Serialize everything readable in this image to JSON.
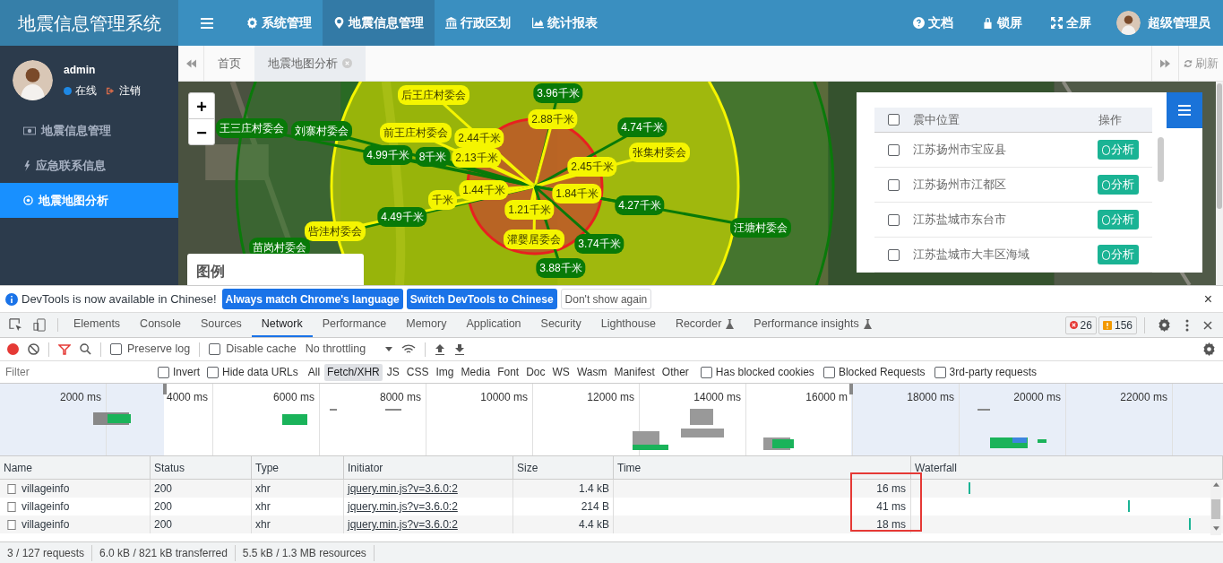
{
  "app": {
    "logo": "地震信息管理系统",
    "nav": [
      {
        "label": "系统管理",
        "kind": "gear",
        "selected": false
      },
      {
        "label": "地震信息管理",
        "kind": "pin",
        "selected": true
      },
      {
        "label": "行政区划",
        "kind": "bank",
        "selected": false
      },
      {
        "label": "统计报表",
        "kind": "chart",
        "selected": false
      }
    ],
    "nav_right": [
      {
        "label": "文档",
        "kind": "help"
      },
      {
        "label": "锁屏",
        "kind": "lock"
      },
      {
        "label": "全屏",
        "kind": "expand"
      }
    ],
    "user_name": "超级管理员",
    "sidebar": {
      "user": "admin",
      "status": "在线",
      "logout": "注销",
      "items": [
        {
          "label": "地震信息管理",
          "kind": "money",
          "selected": false
        },
        {
          "label": "应急联系信息",
          "kind": "bolt",
          "selected": false
        },
        {
          "label": "地震地图分析",
          "kind": "target",
          "selected": true
        }
      ]
    },
    "page_tabs": [
      {
        "label": "首页",
        "selected": false,
        "closable": false
      },
      {
        "label": "地震地图分析",
        "selected": true,
        "closable": true
      }
    ],
    "refresh": "刷新",
    "map": {
      "zoom_in": "+",
      "zoom_out": "−",
      "legend": "图例",
      "labels": [
        {
          "text": "后王庄村委会",
          "color": "#f5f500"
        },
        {
          "text": "3.96千米",
          "color": "#087a08"
        },
        {
          "text": "2.88千米",
          "color": "#f5f500"
        },
        {
          "text": "王三庄村委会",
          "color": "#087a08"
        },
        {
          "text": "刘寨村委会",
          "color": "#087a08"
        },
        {
          "text": "前王庄村委会",
          "color": "#f5f500"
        },
        {
          "text": "2.44千米",
          "color": "#f5f500"
        },
        {
          "text": "4.74千米",
          "color": "#087a08"
        },
        {
          "text": "4.99千米",
          "color": "#087a08"
        },
        {
          "text": "8千米",
          "color": "#087a08"
        },
        {
          "text": "2.13千米",
          "color": "#f5f500"
        },
        {
          "text": "2.45千米",
          "color": "#f5f500"
        },
        {
          "text": "张集村委会",
          "color": "#f5f500"
        },
        {
          "text": "4.49千米",
          "color": "#087a08"
        },
        {
          "text": "千米",
          "color": "#f5f500"
        },
        {
          "text": "1.44千米",
          "color": "#f5f500"
        },
        {
          "text": "1.21千米",
          "color": "#f5f500"
        },
        {
          "text": "1.84千米",
          "color": "#f5f500"
        },
        {
          "text": "4.27千米",
          "color": "#087a08"
        },
        {
          "text": "苗岗村委会",
          "color": "#087a08"
        },
        {
          "text": "呰洼村委会",
          "color": "#f5f500"
        },
        {
          "text": "灌婴居委会",
          "color": "#f5f500"
        },
        {
          "text": "3.74千米",
          "color": "#087a08"
        },
        {
          "text": "汪塘村委会",
          "color": "#087a08"
        },
        {
          "text": "3.88千米",
          "color": "#087a08"
        }
      ]
    },
    "quake_table": {
      "columns": [
        "震中位置",
        "操作"
      ],
      "all_checked": false,
      "rows": [
        {
          "location": "江苏扬州市宝应县",
          "checked": false,
          "action": "分析"
        },
        {
          "location": "江苏扬州市江都区",
          "checked": false,
          "action": "分析"
        },
        {
          "location": "江苏盐城市东台市",
          "checked": false,
          "action": "分析"
        },
        {
          "location": "江苏盐城市大丰区海域",
          "checked": false,
          "action": "分析"
        }
      ]
    }
  },
  "devtools": {
    "infobar": {
      "message": "DevTools is now available in Chinese!",
      "buttons": [
        {
          "label": "Always match Chrome's language",
          "kind": "primary"
        },
        {
          "label": "Switch DevTools to Chinese",
          "kind": "primary"
        },
        {
          "label": "Don't show again",
          "kind": "plain"
        }
      ],
      "close": "×"
    },
    "tabs": [
      {
        "label": "Elements",
        "selected": false,
        "experimental": false
      },
      {
        "label": "Console",
        "selected": false,
        "experimental": false
      },
      {
        "label": "Sources",
        "selected": false,
        "experimental": false
      },
      {
        "label": "Network",
        "selected": true,
        "experimental": false
      },
      {
        "label": "Performance",
        "selected": false,
        "experimental": false
      },
      {
        "label": "Memory",
        "selected": false,
        "experimental": false
      },
      {
        "label": "Application",
        "selected": false,
        "experimental": false
      },
      {
        "label": "Security",
        "selected": false,
        "experimental": false
      },
      {
        "label": "Lighthouse",
        "selected": false,
        "experimental": false
      },
      {
        "label": "Recorder",
        "selected": false,
        "experimental": true
      },
      {
        "label": "Performance insights",
        "selected": false,
        "experimental": true
      }
    ],
    "errors": "26",
    "warnings": "156",
    "toolbar": {
      "recording": true,
      "preserve_log": {
        "label": "Preserve log",
        "checked": false
      },
      "disable_cache": {
        "label": "Disable cache",
        "checked": false
      },
      "throttling": "No throttling"
    },
    "filter": {
      "placeholder": "Filter",
      "options": [
        {
          "label": "Invert",
          "checked": false
        },
        {
          "label": "Hide data URLs",
          "checked": false
        }
      ],
      "types": [
        {
          "label": "All",
          "selected": false
        },
        {
          "label": "Fetch/XHR",
          "selected": true
        },
        {
          "label": "JS",
          "selected": false
        },
        {
          "label": "CSS",
          "selected": false
        },
        {
          "label": "Img",
          "selected": false
        },
        {
          "label": "Media",
          "selected": false
        },
        {
          "label": "Font",
          "selected": false
        },
        {
          "label": "Doc",
          "selected": false
        },
        {
          "label": "WS",
          "selected": false
        },
        {
          "label": "Wasm",
          "selected": false
        },
        {
          "label": "Manifest",
          "selected": false
        },
        {
          "label": "Other",
          "selected": false
        }
      ],
      "extra": [
        {
          "label": "Has blocked cookies",
          "checked": false
        },
        {
          "label": "Blocked Requests",
          "checked": false
        },
        {
          "label": "3rd-party requests",
          "checked": false
        }
      ]
    },
    "timeline_ticks": [
      "2000 ms",
      "4000 ms",
      "6000 ms",
      "8000 ms",
      "10000 ms",
      "12000 ms",
      "14000 ms",
      "16000 m",
      "18000 ms",
      "20000 ms",
      "22000 ms"
    ],
    "requests": {
      "columns": [
        "Name",
        "Status",
        "Type",
        "Initiator",
        "Size",
        "Time",
        "Waterfall"
      ],
      "rows": [
        {
          "name": "villageinfo",
          "status": "200",
          "type": "xhr",
          "initiator": "jquery.min.js?v=3.6.0:2",
          "size": "1.4 kB",
          "time": "16 ms"
        },
        {
          "name": "villageinfo",
          "status": "200",
          "type": "xhr",
          "initiator": "jquery.min.js?v=3.6.0:2",
          "size": "214 B",
          "time": "41 ms"
        },
        {
          "name": "villageinfo",
          "status": "200",
          "type": "xhr",
          "initiator": "jquery.min.js?v=3.6.0:2",
          "size": "4.4 kB",
          "time": "18 ms"
        }
      ]
    },
    "status_bar": [
      "3 / 127 requests",
      "6.0 kB / 821 kB transferred",
      "5.5 kB / 1.3 MB resources"
    ]
  }
}
